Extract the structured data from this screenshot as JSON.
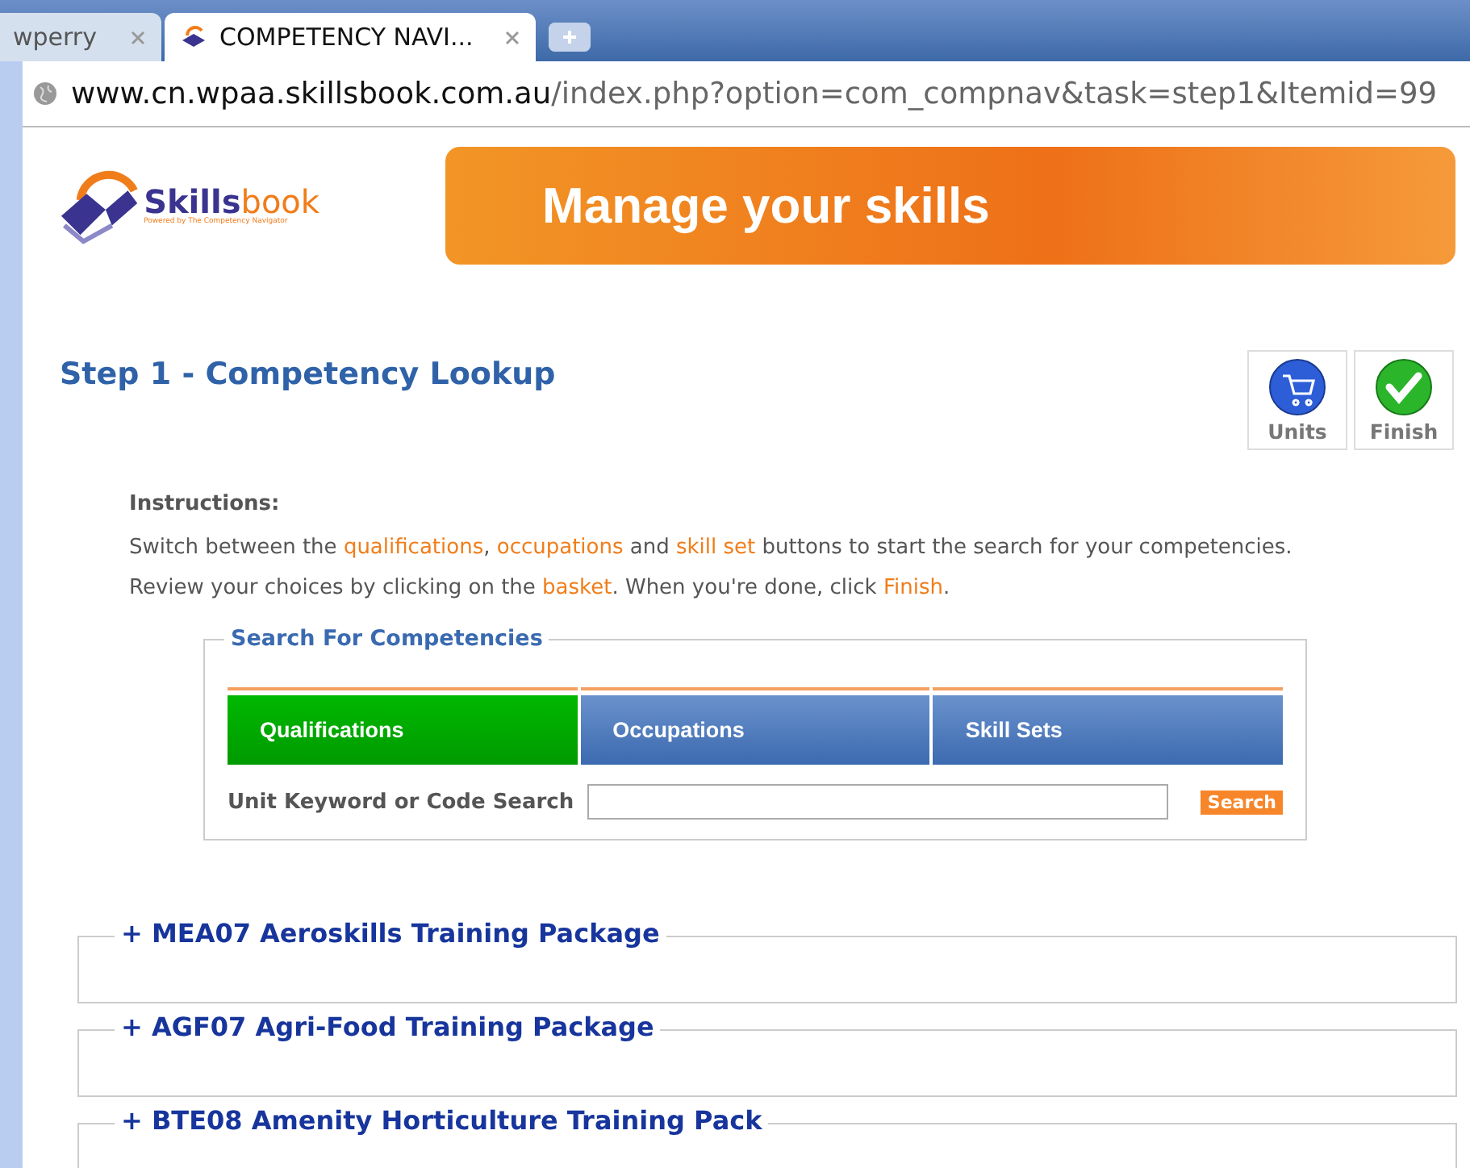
{
  "browser": {
    "tabs": [
      {
        "title": "wperry",
        "selected": false
      },
      {
        "title": "COMPETENCY NAVI...",
        "selected": true
      }
    ],
    "address": {
      "host": "www.cn.wpaa.skillsbook.com.au",
      "path": "/index.php?option=com_compnav&task=step1&Itemid=99"
    }
  },
  "header": {
    "logo": {
      "name_a": "Skills",
      "name_b": "book",
      "tagline": "Powered by The Competency Navigator"
    },
    "banner": "Manage your skills"
  },
  "step_title": "Step 1 - Competency Lookup",
  "actions": [
    {
      "label": "Units",
      "kind": "cart"
    },
    {
      "label": "Finish",
      "kind": "check"
    }
  ],
  "instructions": {
    "heading": "Instructions:",
    "lines": [
      [
        {
          "text": "Switch between the ",
          "kind": "plain"
        },
        {
          "text": "qualifications",
          "kind": "link"
        },
        {
          "text": ", ",
          "kind": "plain"
        },
        {
          "text": "occupations",
          "kind": "link"
        },
        {
          "text": " and ",
          "kind": "plain"
        },
        {
          "text": "skill set",
          "kind": "link"
        },
        {
          "text": " buttons to start the search for your competencies.",
          "kind": "plain"
        }
      ],
      [
        {
          "text": "Review your choices by clicking on the ",
          "kind": "plain"
        },
        {
          "text": "basket",
          "kind": "link"
        },
        {
          "text": ". When you're done, click ",
          "kind": "plain"
        },
        {
          "text": "Finish",
          "kind": "link"
        },
        {
          "text": ".",
          "kind": "plain"
        }
      ]
    ]
  },
  "search": {
    "legend": "Search For Competencies",
    "tabs": [
      {
        "label": "Qualifications",
        "selected": true
      },
      {
        "label": "Occupations",
        "selected": false
      },
      {
        "label": "Skill Sets",
        "selected": false
      }
    ],
    "field_label": "Unit Keyword or Code Search",
    "button": "Search"
  },
  "packages": [
    {
      "title": "+ MEA07 Aeroskills Training Package"
    },
    {
      "title": "+ AGF07 Agri-Food Training Package"
    },
    {
      "title": "+ BTE08 Amenity Horticulture Training Pack"
    }
  ]
}
